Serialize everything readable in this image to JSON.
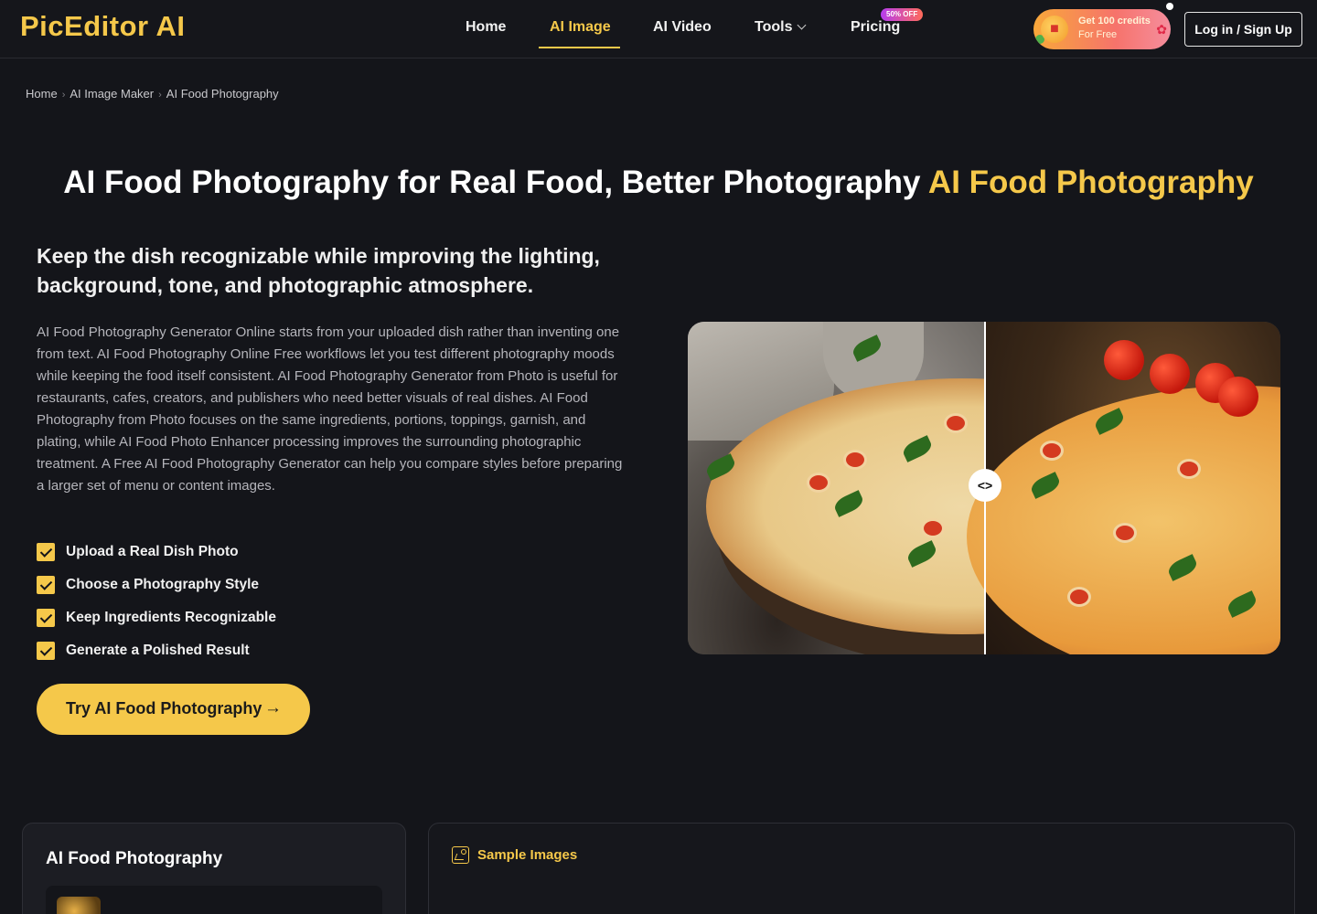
{
  "header": {
    "logo": "PicEditor AI",
    "nav": {
      "home": "Home",
      "ai_image": "AI Image",
      "ai_video": "AI Video",
      "tools": "Tools",
      "pricing": "Pricing",
      "pricing_badge": "50% OFF"
    },
    "credits": {
      "line1": "Get 100 credits",
      "line2": "For Free"
    },
    "login": "Log in / Sign Up"
  },
  "breadcrumb": [
    "Home",
    "AI Image Maker",
    "AI Food Photography"
  ],
  "hero": {
    "title_main": "AI Food Photography for Real Food, Better Photography",
    "title_highlight": "AI Food Photography",
    "subtitle": "Keep the dish recognizable while improving the lighting, background, tone, and photographic atmosphere.",
    "description": "AI Food Photography Generator Online starts from your uploaded dish rather than inventing one from text. AI Food Photography Online Free workflows let you test different photography moods while keeping the food itself consistent. AI Food Photography Generator from Photo is useful for restaurants, cafes, creators, and publishers who need better visuals of real dishes. AI Food Photography from Photo focuses on the same ingredients, portions, toppings, garnish, and plating, while AI Food Photo Enhancer processing improves the surrounding photographic treatment. A Free AI Food Photography Generator can help you compare styles before preparing a larger set of menu or content images.",
    "checklist": [
      "Upload a Real Dish Photo",
      "Choose a Photography Style",
      "Keep Ingredients Recognizable",
      "Generate a Polished Result"
    ],
    "cta": "Try AI Food Photography",
    "compare_handle": "<>"
  },
  "panels": {
    "left_title": "AI Food Photography",
    "right_title": "Sample Images"
  },
  "colors": {
    "accent": "#f5c84a",
    "background": "#14151a"
  }
}
